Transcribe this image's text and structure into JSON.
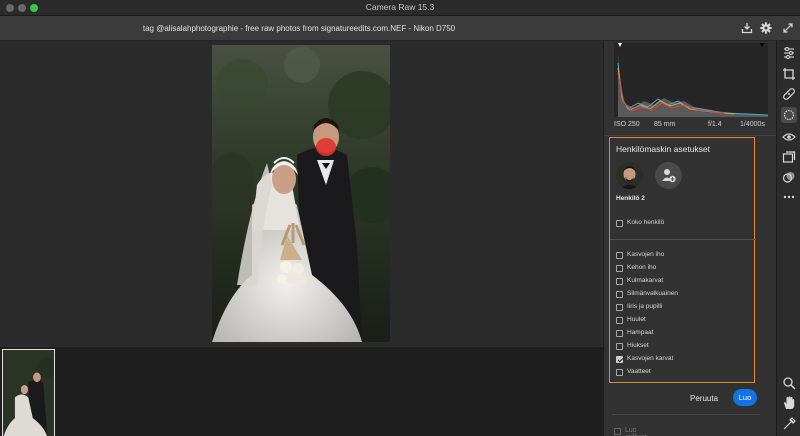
{
  "app": {
    "title": "Camera Raw 15.3"
  },
  "file": {
    "title": "tag @alisalahphotographie - free raw photos from signatureedits.com.NEF  -  Nikon D750"
  },
  "exif": {
    "iso": "ISO 250",
    "focal": "85 mm",
    "aperture": "f/1.4",
    "shutter": "1/4000s"
  },
  "mask_panel": {
    "title": "Henkilömaskin asetukset",
    "person_label": "Henkilö 2",
    "whole_person": {
      "label": "Koko henkilö",
      "checked": false
    },
    "options": [
      {
        "label": "Kasvojen iho",
        "checked": false
      },
      {
        "label": "Kehon iho",
        "checked": false
      },
      {
        "label": "Kulmakarvat",
        "checked": false
      },
      {
        "label": "Silmänvalkuainen",
        "checked": false
      },
      {
        "label": "Iiris ja pupilli",
        "checked": false
      },
      {
        "label": "Huulet",
        "checked": false
      },
      {
        "label": "Hampaat",
        "checked": false
      },
      {
        "label": "Hiukset",
        "checked": false
      },
      {
        "label": "Kasvojen karvat",
        "checked": true
      },
      {
        "label": "Vaatteet",
        "checked": false
      }
    ]
  },
  "actions": {
    "cancel": "Peruuta",
    "create": "Luo"
  },
  "separate_masks": {
    "label": "Luo erilliset maskit",
    "checked": false
  },
  "toolbar": {
    "tools": [
      "edit-sliders-icon",
      "crop-icon",
      "heal-icon",
      "masking-icon",
      "redeye-icon",
      "snapshots-icon",
      "presets-icon",
      "more-icon",
      "zoom-icon",
      "hand-icon",
      "sampler-icon"
    ]
  },
  "colors": {
    "accent": "#1473e6",
    "mask_outline": "#e08a2c",
    "mask_overlay": "#e0332b"
  }
}
